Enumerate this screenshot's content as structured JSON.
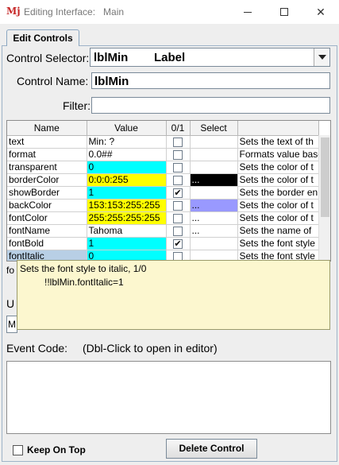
{
  "window": {
    "title": "Editing Interface:   Main",
    "icon": "app-logo-icon"
  },
  "tab": {
    "label": "Edit Controls"
  },
  "selector": {
    "label": "Control Selector:",
    "name": "lblMin",
    "type": "Label"
  },
  "control_name": {
    "label": "Control Name:",
    "value": "lblMin"
  },
  "filter": {
    "label": "Filter:",
    "value": ""
  },
  "table": {
    "headers": [
      "Name",
      "Value",
      "0/1",
      "Select",
      ""
    ],
    "rows": [
      {
        "name": "text",
        "value": "Min: ?",
        "checked": false,
        "select": "",
        "desc": "Sets the text of th"
      },
      {
        "name": "format",
        "value": "0.0##",
        "checked": false,
        "select": "",
        "desc": "Formats value base"
      },
      {
        "name": "transparent",
        "value": "0",
        "checked": false,
        "select": "",
        "desc": "Sets the color of t"
      },
      {
        "name": "borderColor",
        "value": "0:0:0:255",
        "checked": false,
        "select": "...",
        "desc": "Sets the color of t"
      },
      {
        "name": "showBorder",
        "value": "1",
        "checked": true,
        "select": "",
        "desc": "Sets the border en"
      },
      {
        "name": "backColor",
        "value": "153:153:255:255",
        "checked": false,
        "select": "...",
        "desc": "Sets the color of t"
      },
      {
        "name": "fontColor",
        "value": "255:255:255:255",
        "checked": false,
        "select": "...",
        "desc": "Sets the color of t"
      },
      {
        "name": "fontName",
        "value": "Tahoma",
        "checked": false,
        "select": "...",
        "desc": "Sets the name of "
      },
      {
        "name": "fontBold",
        "value": "1",
        "checked": true,
        "select": "",
        "desc": "Sets the font style"
      },
      {
        "name": "fontItalic",
        "value": "0",
        "checked": false,
        "select": "",
        "desc": "Sets the font style"
      }
    ],
    "colors": {
      "cyan": "#00ffff",
      "yellow": "#ffff00",
      "black": "#000000",
      "lavender": "#9999ff"
    }
  },
  "tooltip": {
    "line1": "Sets the font style to italic, 1/0",
    "line2": "!!lblMin.fontItalic=1"
  },
  "hidden_labels": {
    "u": "U",
    "m": "M",
    "f": "fo"
  },
  "event_code": {
    "label": "Event Code:",
    "hint": "(Dbl-Click to open in editor)"
  },
  "keep_on_top": {
    "label": "Keep On Top"
  },
  "delete_button": {
    "label": "Delete Control"
  },
  "check_glyph": "✔"
}
